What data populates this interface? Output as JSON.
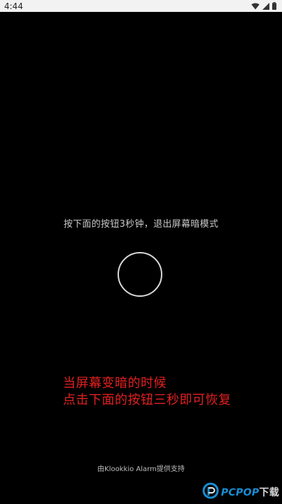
{
  "status_bar": {
    "time": "4:44"
  },
  "main": {
    "instruction": "按下面的按钮3秒钟，退出屏幕暗模式",
    "exit_button_icon": "circle-outline"
  },
  "overlay_tip": {
    "line1": "当屏幕变暗的时候",
    "line2": "点击下面的按钮三秒即可恢复",
    "color": "#e32020"
  },
  "footer": {
    "powered_by": "由Klookkio Alarm提供支持"
  },
  "watermark": {
    "brand": "PCPOP",
    "suffix": "下载"
  }
}
